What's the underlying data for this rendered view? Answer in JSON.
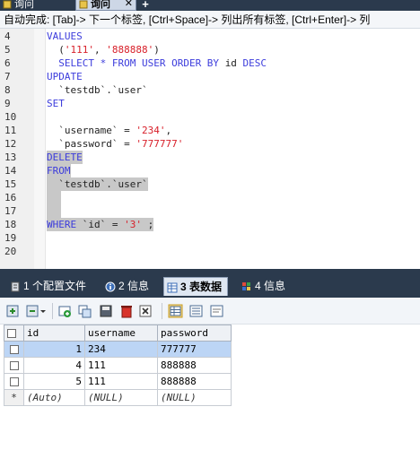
{
  "query_tabs": [
    {
      "label": "询问",
      "active": false
    },
    {
      "label": "询问",
      "active": true
    }
  ],
  "add_tab_label": "+",
  "close_glyph": "✕",
  "hint": "自动完成: [Tab]-> 下一个标签, [Ctrl+Space]-> 列出所有标签, [Ctrl+Enter]-> 列",
  "editor_lines": [
    {
      "n": "4",
      "tokens": [
        {
          "t": "VALUES",
          "c": "kw"
        }
      ]
    },
    {
      "n": "5",
      "tokens": [
        {
          "t": "  (",
          "c": "id"
        },
        {
          "t": "'111'",
          "c": "str"
        },
        {
          "t": ", ",
          "c": "id"
        },
        {
          "t": "'888888'",
          "c": "str"
        },
        {
          "t": ")",
          "c": "id"
        }
      ]
    },
    {
      "n": "6",
      "tokens": [
        {
          "t": "  SELECT * FROM USER ORDER BY ",
          "c": "kw"
        },
        {
          "t": "id",
          "c": "id"
        },
        {
          "t": " DESC",
          "c": "kw"
        }
      ]
    },
    {
      "n": "7",
      "tokens": [
        {
          "t": "UPDATE",
          "c": "kw"
        }
      ]
    },
    {
      "n": "8",
      "tokens": [
        {
          "t": "  `testdb`.`user`",
          "c": "id"
        }
      ]
    },
    {
      "n": "9",
      "tokens": [
        {
          "t": "SET",
          "c": "kw"
        }
      ]
    },
    {
      "n": "10",
      "tokens": []
    },
    {
      "n": "11",
      "tokens": [
        {
          "t": "  `username` = ",
          "c": "id"
        },
        {
          "t": "'234'",
          "c": "str"
        },
        {
          "t": ",",
          "c": "id"
        }
      ]
    },
    {
      "n": "12",
      "tokens": [
        {
          "t": "  `password` = ",
          "c": "id"
        },
        {
          "t": "'777777'",
          "c": "str"
        }
      ]
    },
    {
      "n": "13",
      "sel": true,
      "tokens": [
        {
          "t": "DELETE",
          "c": "kw"
        }
      ]
    },
    {
      "n": "14",
      "sel": true,
      "tokens": [
        {
          "t": "FROM",
          "c": "kw"
        }
      ]
    },
    {
      "n": "15",
      "sel": true,
      "tokens": [
        {
          "t": "  `testdb`.`user`",
          "c": "id"
        }
      ]
    },
    {
      "n": "16",
      "sel": true,
      "tokens": [
        {
          "t": "  ",
          "c": "id"
        }
      ]
    },
    {
      "n": "17",
      "sel": true,
      "tokens": [
        {
          "t": "  ",
          "c": "id"
        }
      ]
    },
    {
      "n": "18",
      "sel": true,
      "tokens": [
        {
          "t": "WHERE ",
          "c": "kw"
        },
        {
          "t": "`id` = ",
          "c": "id"
        },
        {
          "t": "'3'",
          "c": "str"
        },
        {
          "t": " ;",
          "c": "id"
        }
      ]
    },
    {
      "n": "19",
      "tokens": []
    },
    {
      "n": "20",
      "tokens": []
    }
  ],
  "result_tabs": [
    {
      "label": "1 个配置文件",
      "icon": "profile-icon",
      "active": false
    },
    {
      "label": "2 信息",
      "icon": "info-icon",
      "active": false
    },
    {
      "label": "3 表数据",
      "icon": "table-icon",
      "active": true
    },
    {
      "label": "4 信息",
      "icon": "info-grid-icon",
      "active": false
    }
  ],
  "grid": {
    "columns": [
      "id",
      "username",
      "password"
    ],
    "rows": [
      {
        "id": "1",
        "username": "234",
        "password": "777777",
        "selected": true
      },
      {
        "id": "4",
        "username": "111",
        "password": "888888",
        "selected": false
      },
      {
        "id": "5",
        "username": "111",
        "password": "888888",
        "selected": false
      }
    ],
    "new_row": {
      "marker": "*",
      "id": "(Auto)",
      "username": "(NULL)",
      "password": "(NULL)"
    }
  },
  "colors": {
    "tab_bar": "#2b3a4d",
    "keyword": "#3c3cdc",
    "string": "#d8202a",
    "selection": "#c8c8c8",
    "selected_row": "#bcd5f5"
  }
}
